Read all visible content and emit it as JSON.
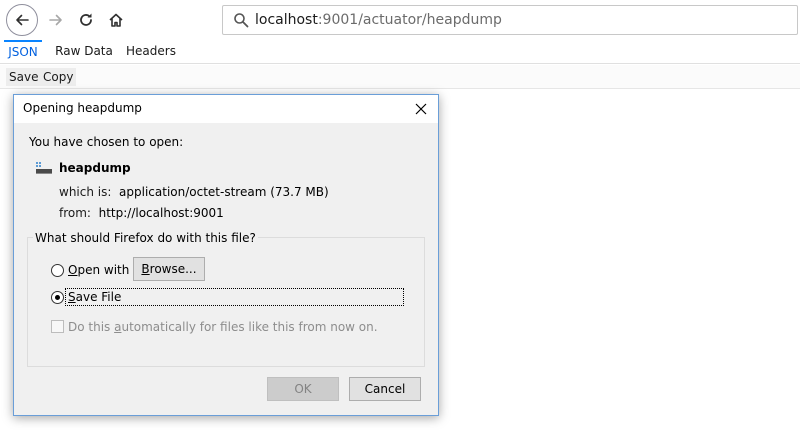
{
  "browser": {
    "url_host": "localhost",
    "url_rest": ":9001/actuator/heapdump"
  },
  "viewer": {
    "tabs": [
      "JSON",
      "Raw Data",
      "Headers"
    ],
    "toolbar": [
      "Save",
      "Copy"
    ]
  },
  "dialog": {
    "title": "Opening heapdump",
    "chosen_text": "You have chosen to open:",
    "filename": "heapdump",
    "which_is_label": "which is:",
    "which_is_value": "application/octet-stream (73.7 MB)",
    "from_label": "from:",
    "from_value": "http://localhost:9001",
    "question": "What should Firefox do with this file?",
    "open_with_prefix": "O",
    "open_with_rest": "pen with",
    "browse_prefix": "B",
    "browse_rest": "rowse...",
    "save_prefix": "S",
    "save_rest": "ave File",
    "auto_pre": "Do this ",
    "auto_u": "a",
    "auto_post": "utomatically for files like this from now on.",
    "ok_label": "OK",
    "cancel_label": "Cancel",
    "selected_option": "Save File"
  },
  "colors": {
    "accent": "#0a84ff",
    "dialog_border": "#6a9ed8",
    "dialog_bg": "#f0f0f0"
  }
}
